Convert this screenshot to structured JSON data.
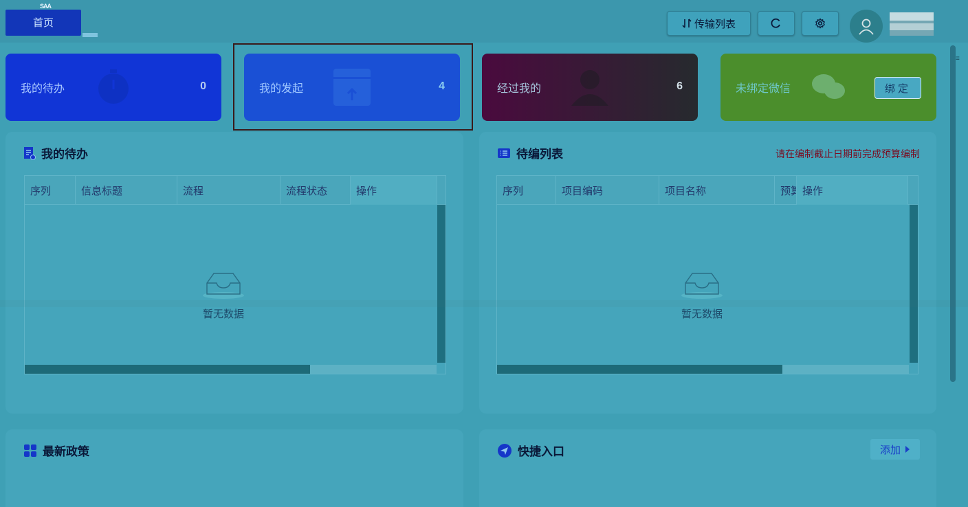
{
  "topbar": {
    "home_tab": "首页",
    "logo_text": "SAA",
    "transfer_list": "传输列表",
    "refresh_icon": "refresh-icon",
    "settings_icon": "settings-icon"
  },
  "cards": {
    "todo": {
      "label": "我的待办",
      "count": "0"
    },
    "initiated": {
      "label": "我的发起",
      "count": "4"
    },
    "passed": {
      "label": "经过我的",
      "count": "6"
    },
    "wechat": {
      "label": "未绑定微信",
      "button": "绑定"
    }
  },
  "todo_panel": {
    "title": "我的待办",
    "columns": [
      "序列",
      "信息标题",
      "流程",
      "流程状态",
      "操作"
    ],
    "empty_text": "暂无数据"
  },
  "edit_panel": {
    "title": "待编列表",
    "note": "请在编制截止日期前完成预算编制",
    "columns": [
      "序列",
      "项目编码",
      "项目名称",
      "预算",
      "操作"
    ],
    "empty_text": "暂无数据"
  },
  "policy_panel": {
    "title": "最新政策"
  },
  "quick_panel": {
    "title": "快捷入口",
    "add_button": "添加"
  },
  "colors": {
    "page_bg": "#3fa0b5",
    "todo_card": "#1135d6",
    "initiated_card": "#1a50d5",
    "passed_card": "#4a0a3e",
    "wechat_card": "#4b8e2c",
    "note_red": "#7a0d22"
  }
}
